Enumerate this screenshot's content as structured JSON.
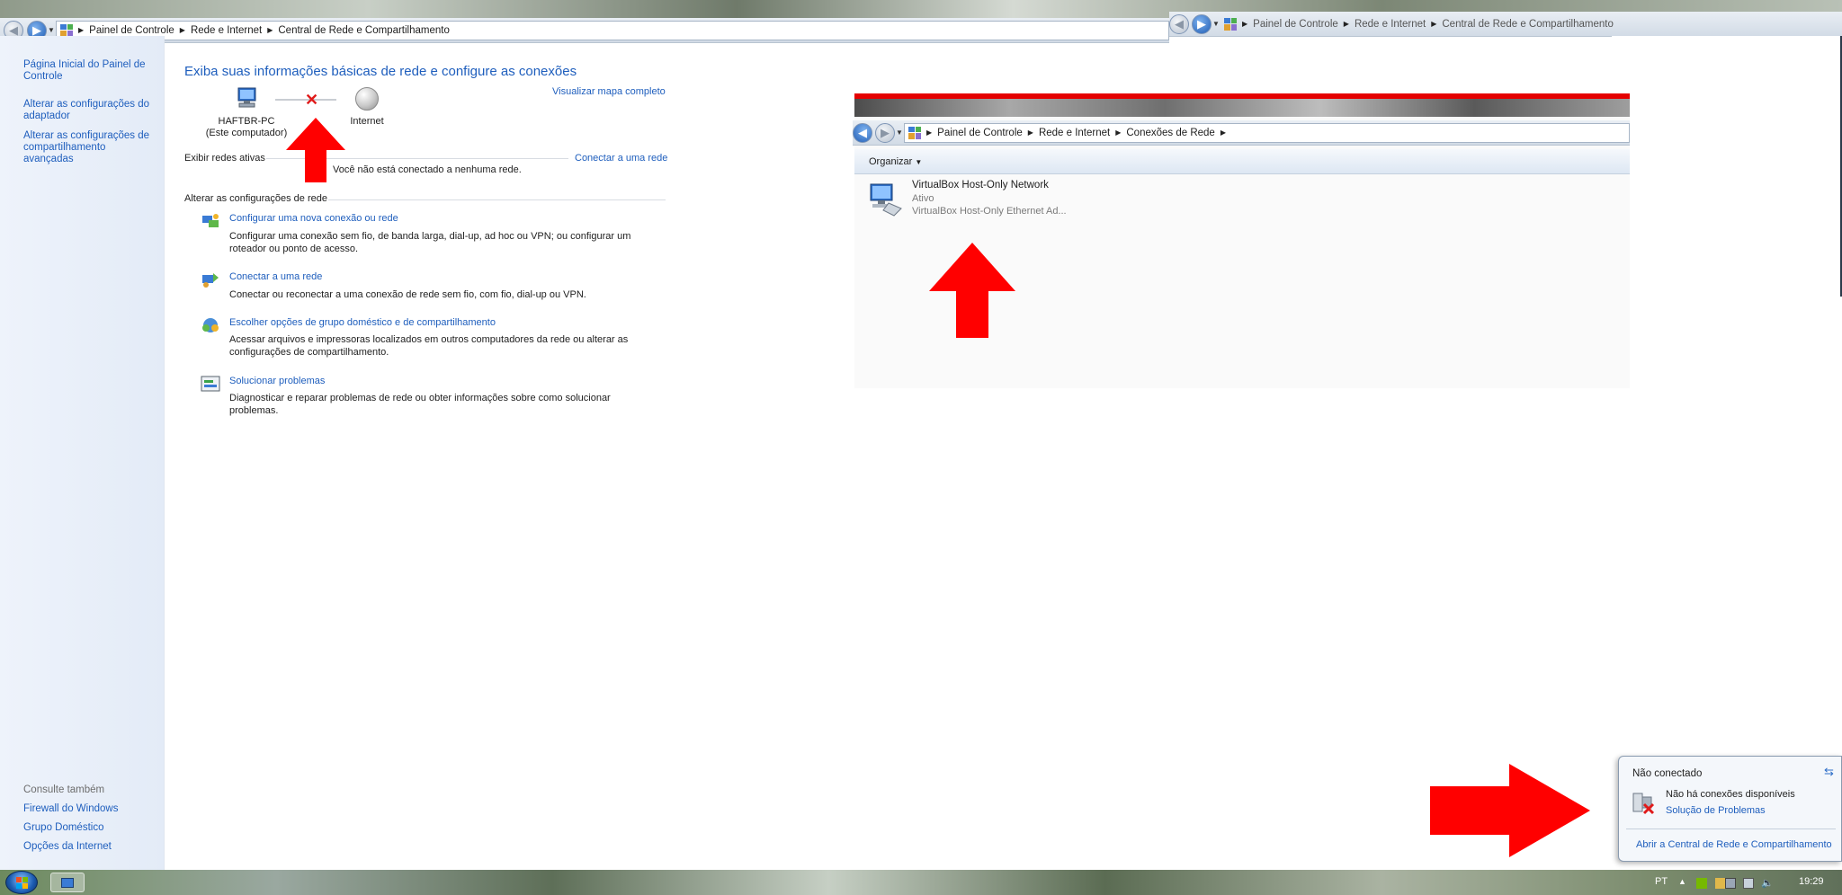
{
  "address_bar_main": {
    "crumbs": [
      "Painel de Controle",
      "Rede e Internet",
      "Central de Rede e Compartilhamento"
    ]
  },
  "address_bar_overlay": {
    "crumbs": [
      "Painel de Controle",
      "Rede e Internet",
      "Central de Rede e Compartilhamento"
    ]
  },
  "sidebar": {
    "items": [
      {
        "label": "Página Inicial do Painel de Controle"
      },
      {
        "label": "Alterar as configurações do adaptador"
      },
      {
        "label": "Alterar as configurações de compartilhamento avançadas"
      }
    ],
    "see_also_label": "Consulte também",
    "see_also": [
      {
        "label": "Firewall do Windows"
      },
      {
        "label": "Grupo Doméstico"
      },
      {
        "label": "Opções da Internet"
      }
    ]
  },
  "main": {
    "title": "Exiba suas informações básicas de rede e configure as conexões",
    "view_full_map": "Visualizar mapa completo",
    "computer_name": "HAFTBR-PC",
    "computer_sub": "(Este computador)",
    "internet_label": "Internet",
    "active_networks_label": "Exibir redes ativas",
    "connect_link": "Conectar a uma rede",
    "not_connected_text": "Você não está conectado a nenhuma rede.",
    "change_settings_label": "Alterar as configurações de rede",
    "tasks": [
      {
        "title": "Configurar uma nova conexão ou rede",
        "desc": "Configurar uma conexão sem fio, de banda larga, dial-up, ad hoc ou VPN; ou configurar um roteador ou ponto de acesso."
      },
      {
        "title": "Conectar a uma rede",
        "desc": "Conectar ou reconectar a uma conexão de rede sem fio, com fio, dial-up ou VPN."
      },
      {
        "title": "Escolher opções de grupo doméstico e de compartilhamento",
        "desc": "Acessar arquivos e impressoras localizados em outros computadores da rede ou alterar as configurações de compartilhamento."
      },
      {
        "title": "Solucionar problemas",
        "desc": "Diagnosticar e reparar problemas de rede ou obter informações sobre como solucionar problemas."
      }
    ]
  },
  "connections_window": {
    "crumbs": [
      "Painel de Controle",
      "Rede e Internet",
      "Conexões de Rede"
    ],
    "organize_label": "Organizar",
    "adapter": {
      "name": "VirtualBox Host-Only Network",
      "status": "Ativo",
      "device": "VirtualBox Host-Only Ethernet Ad..."
    }
  },
  "popup": {
    "title": "Não conectado",
    "message": "Não há conexões disponíveis",
    "troubleshoot_link": "Solução de Problemas",
    "open_center_link": "Abrir a Central de Rede e Compartilhamento"
  },
  "taskbar": {
    "language": "PT",
    "clock": "19:29"
  },
  "colors": {
    "link": "#1e5ebd",
    "annotation_arrow": "#ff0000"
  }
}
